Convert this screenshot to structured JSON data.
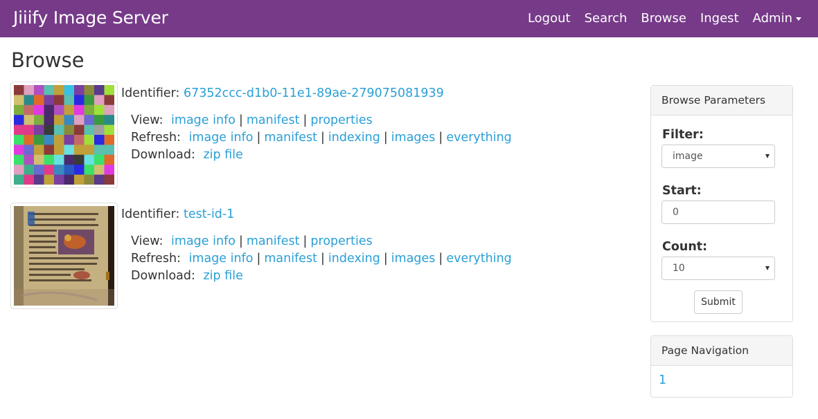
{
  "navbar": {
    "brand": "Jiiify Image Server",
    "links": [
      "Logout",
      "Search",
      "Browse",
      "Ingest",
      "Admin"
    ]
  },
  "page_title": "Browse",
  "items": [
    {
      "identifier_label": "Identifier:",
      "identifier": "67352ccc-d1b0-11e1-89ae-279075081939",
      "view_label": "View:",
      "view_links": [
        "image info",
        "manifest",
        "properties"
      ],
      "refresh_label": "Refresh:",
      "refresh_links": [
        "image info",
        "manifest",
        "indexing",
        "images",
        "everything"
      ],
      "download_label": "Download:",
      "download_link": "zip file"
    },
    {
      "identifier_label": "Identifier:",
      "identifier": "test-id-1",
      "view_label": "View:",
      "view_links": [
        "image info",
        "manifest",
        "properties"
      ],
      "refresh_label": "Refresh:",
      "refresh_links": [
        "image info",
        "manifest",
        "indexing",
        "images",
        "everything"
      ],
      "download_label": "Download:",
      "download_link": "zip file"
    }
  ],
  "browse_params": {
    "title": "Browse Parameters",
    "filter_label": "Filter:",
    "filter_value": "image",
    "start_label": "Start:",
    "start_value": "0",
    "count_label": "Count:",
    "count_value": "10",
    "submit_label": "Submit"
  },
  "page_nav": {
    "title": "Page Navigation",
    "pages": [
      "1"
    ]
  },
  "colors": {
    "navbar": "#763a88",
    "link": "#2a9fd6"
  }
}
